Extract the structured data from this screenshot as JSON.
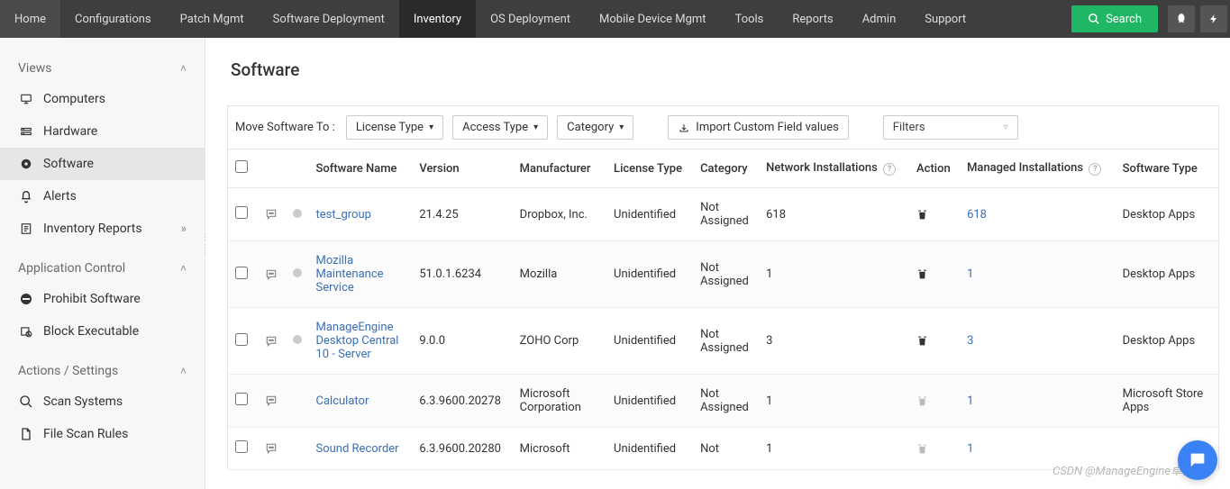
{
  "topnav": {
    "items": [
      "Home",
      "Configurations",
      "Patch Mgmt",
      "Software Deployment",
      "Inventory",
      "OS Deployment",
      "Mobile Device Mgmt",
      "Tools",
      "Reports",
      "Admin",
      "Support"
    ],
    "active_index": 4,
    "search_label": "Search"
  },
  "sidebar": {
    "sections": [
      {
        "title": "Views",
        "items": [
          {
            "icon": "monitor",
            "label": "Computers"
          },
          {
            "icon": "hardware",
            "label": "Hardware"
          },
          {
            "icon": "software",
            "label": "Software",
            "active": true
          },
          {
            "icon": "bell",
            "label": "Alerts"
          },
          {
            "icon": "report",
            "label": "Inventory Reports",
            "chevron": true
          }
        ]
      },
      {
        "title": "Application Control",
        "items": [
          {
            "icon": "prohibit",
            "label": "Prohibit Software"
          },
          {
            "icon": "block",
            "label": "Block Executable"
          }
        ]
      },
      {
        "title": "Actions / Settings",
        "items": [
          {
            "icon": "scan",
            "label": "Scan Systems"
          },
          {
            "icon": "filescan",
            "label": "File Scan Rules"
          }
        ]
      }
    ]
  },
  "page": {
    "title": "Software"
  },
  "toolbar": {
    "move_label": "Move Software To :",
    "license_type": "License Type",
    "access_type": "Access Type",
    "category": "Category",
    "import_label": "Import Custom Field values",
    "filters": "Filters"
  },
  "table": {
    "columns": [
      "",
      "",
      "",
      "Software Name",
      "Version",
      "Manufacturer",
      "License Type",
      "Category",
      "Network Installations",
      "Action",
      "Managed Installations",
      "Software Type"
    ],
    "help_cols": [
      8,
      10
    ],
    "rows": [
      {
        "name": "test_group",
        "version": "21.4.25",
        "manufacturer": "Dropbox, Inc.",
        "license": "Unidentified",
        "category": "Not Assigned",
        "net": "618",
        "managed": "618",
        "type": "Desktop Apps",
        "action": "active",
        "dot": true
      },
      {
        "name": "Mozilla Maintenance Service",
        "version": "51.0.1.6234",
        "manufacturer": "Mozilla",
        "license": "Unidentified",
        "category": "Not Assigned",
        "net": "1",
        "managed": "1",
        "type": "Desktop Apps",
        "action": "active",
        "dot": true
      },
      {
        "name": "ManageEngine Desktop Central 10 - Server",
        "version": "9.0.0",
        "manufacturer": "ZOHO Corp",
        "license": "Unidentified",
        "category": "Not Assigned",
        "net": "3",
        "managed": "3",
        "type": "Desktop Apps",
        "action": "active",
        "dot": true
      },
      {
        "name": "Calculator",
        "version": "6.3.9600.20278",
        "manufacturer": "Microsoft Corporation",
        "license": "Unidentified",
        "category": "Not Assigned",
        "net": "1",
        "managed": "1",
        "type": "Microsoft Store Apps",
        "action": "disabled",
        "dot": false
      },
      {
        "name": "Sound Recorder",
        "version": "6.3.9600.20280",
        "manufacturer": "Microsoft",
        "license": "Unidentified",
        "category": "Not",
        "net": "1",
        "managed": "1",
        "type": "",
        "action": "disabled",
        "dot": false
      }
    ]
  },
  "watermark": "CSDN @ManageEngine卓豪"
}
